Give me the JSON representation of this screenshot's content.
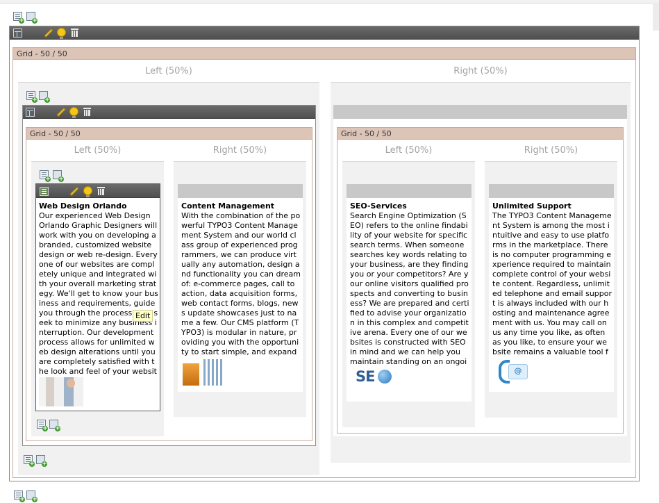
{
  "labels": {
    "grid": "Grid - 50 / 50",
    "left": "Left (50%)",
    "right": "Right (50%)",
    "tooltip": "Edit"
  },
  "elements": [
    {
      "title": "Web Design Orlando",
      "body": "Our experienced Web Design Orlando Graphic Designers will work with you on developing a branded, customized website design or web re-design. Every one of our websites are completely unique and integrated with your overall marketing strategy. We'll get to know your business and requirements, guide you through the process, and seek to minimize any business interruption. Our development process allows for unlimited web design alterations until you are completely satisfied with the look and feel of your website. more"
    },
    {
      "title": "Content Management",
      "body": "With the combination of the powerful TYPO3 Content Management System and our world class group of experienced programmers, we can produce virtually any automation, design and functionality you can dream of: e-commerce pages, call to action, data acquisition forms, web contact forms, blogs, news update showcases just to name a few. Our CMS platform (TYPO3) is modular in nature, providing you with the opportunity to start simple, and expand with more functionality later on. more"
    },
    {
      "title": "SEO-Services",
      "body": "Search Engine Optimization (SEO) refers to the online findability of your website for specific search terms. When someone searches key words relating to your business, are they finding you or your competitors? Are your online visitors qualified prospects and converting to business? We are prepared and certified to advise your organization in this complex and competitive arena. Every one of our websites is constructed with SEO in mind and we can help you maintain standing on an ongoing basis. more"
    },
    {
      "title": "Unlimited Support",
      "body": "The TYPO3 Content Management System is among the most intuitive and easy to use platforms in the marketplace. There is no computer programming experience required to maintain complete control of your website content. Regardless, unlimited telephone and email support is always included with our hosting and maintenance agreement with us. You may call on us any time you like, as often as you like, to ensure your website remains a valuable tool for your online visitors. more"
    }
  ],
  "icons": [
    "new-content-icon",
    "paste-icon",
    "content-type-icon",
    "edit-icon",
    "hide-icon",
    "delete-icon"
  ]
}
